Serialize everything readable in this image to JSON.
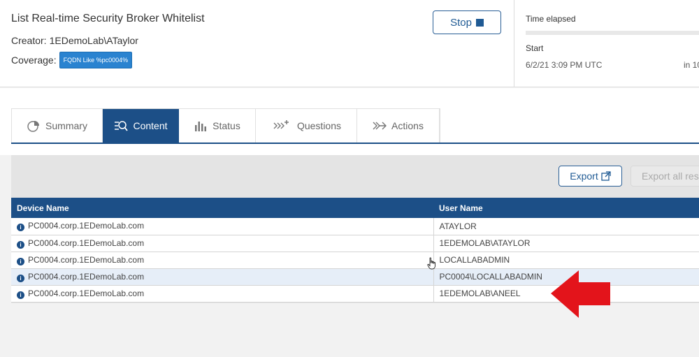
{
  "header": {
    "title": "List Real-time Security Broker Whitelist",
    "creator_label": "Creator:",
    "creator_value": "1EDemoLab\\ATaylor",
    "coverage_label": "Coverage:",
    "coverage_badge": "FQDN Like %pc0004%",
    "stop_label": "Stop"
  },
  "status_panel": {
    "time_elapsed_label": "Time elapsed",
    "start_label": "Start",
    "start_value": "6/2/21 3:09 PM UTC",
    "in_value": "in 10"
  },
  "tabs": [
    {
      "label": "Summary",
      "icon": "pie-chart-icon",
      "active": false
    },
    {
      "label": "Content",
      "icon": "list-search-icon",
      "active": true
    },
    {
      "label": "Status",
      "icon": "bar-chart-icon",
      "active": false
    },
    {
      "label": "Questions",
      "icon": "questions-icon",
      "active": false
    },
    {
      "label": "Actions",
      "icon": "actions-icon",
      "active": false
    }
  ],
  "toolbar": {
    "export_label": "Export",
    "export_all_label": "Export all res"
  },
  "table": {
    "columns": [
      "Device Name",
      "User Name"
    ],
    "rows": [
      {
        "device": "PC0004.corp.1EDemoLab.com",
        "user": "ATAYLOR"
      },
      {
        "device": "PC0004.corp.1EDemoLab.com",
        "user": "1EDEMOLAB\\ATAYLOR"
      },
      {
        "device": "PC0004.corp.1EDemoLab.com",
        "user": "LOCALLABADMIN"
      },
      {
        "device": "PC0004.corp.1EDemoLab.com",
        "user": "PC0004\\LOCALLABADMIN"
      },
      {
        "device": "PC0004.corp.1EDemoLab.com",
        "user": "1EDEMOLAB\\ANEEL"
      }
    ]
  },
  "colors": {
    "primary": "#1c4f87",
    "badge": "#2a83d0",
    "annotation_arrow": "#e3141b"
  }
}
